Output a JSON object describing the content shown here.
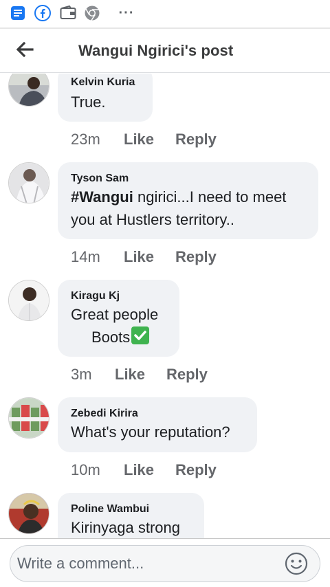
{
  "status_bar": {
    "icons": [
      "notes-icon",
      "facebook-icon",
      "wallet-icon",
      "chrome-icon",
      "more-icon"
    ],
    "more_glyph": "···"
  },
  "header": {
    "title": "Wangui Ngirici's post",
    "back_icon": "arrow-left-icon"
  },
  "comments": [
    {
      "author": "Kelvin Kuria",
      "text_lines": [
        "True."
      ],
      "time": "23m",
      "like_label": "Like",
      "reply_label": "Reply"
    },
    {
      "author": "Tyson Sam",
      "mention": "#Wangui",
      "text_lines": [
        " ngirici...I need to meet",
        "you at Hustlers territory.."
      ],
      "time": "14m",
      "like_label": "Like",
      "reply_label": "Reply"
    },
    {
      "author": "Kiragu Kj",
      "text_lines": [
        "Great people",
        "Boots"
      ],
      "emoji": "check-mark-button-icon",
      "time": "3m",
      "like_label": "Like",
      "reply_label": "Reply"
    },
    {
      "author": "Zebedi Kirira",
      "text_lines": [
        "What's your reputation?"
      ],
      "time": "10m",
      "like_label": "Like",
      "reply_label": "Reply"
    },
    {
      "author": "Poline Wambui",
      "text_lines": [
        "Kirinyaga strong"
      ]
    }
  ],
  "composer": {
    "placeholder": "Write a comment...",
    "emoji_icon": "smiley-icon"
  },
  "colors": {
    "facebook_blue": "#1877f2",
    "bubble_bg": "#f0f2f5",
    "meta_gray": "#65676b"
  }
}
